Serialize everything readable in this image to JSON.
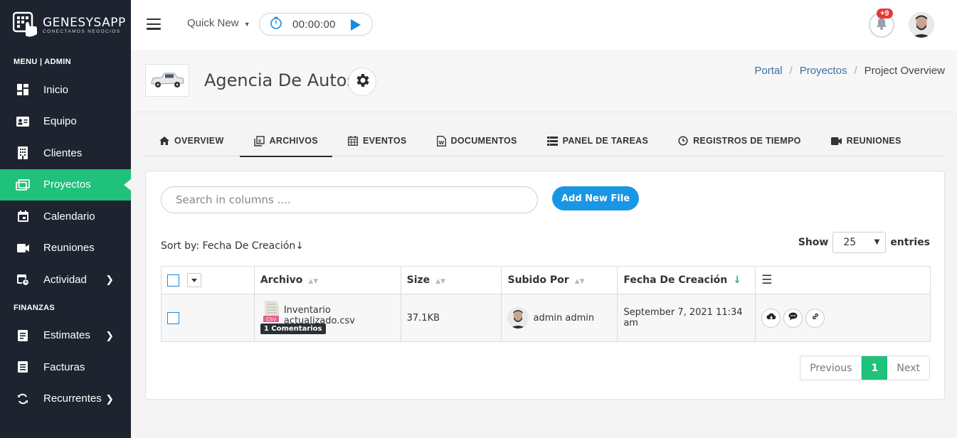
{
  "logo": {
    "title": "GENESYSAPP",
    "subtitle": "CONECTAMOS NEGOCIOS"
  },
  "sidebar": {
    "menu_section": "MENU | ADMIN",
    "menu_items": [
      {
        "label": "Inicio",
        "icon": "dashboard-icon",
        "active": false,
        "has_submenu": false
      },
      {
        "label": "Equipo",
        "icon": "id-card-icon",
        "active": false,
        "has_submenu": false
      },
      {
        "label": "Clientes",
        "icon": "building-icon",
        "active": false,
        "has_submenu": false
      },
      {
        "label": "Proyectos",
        "icon": "folders-icon",
        "active": true,
        "has_submenu": false
      },
      {
        "label": "Calendario",
        "icon": "calendar-icon",
        "active": false,
        "has_submenu": false
      },
      {
        "label": "Reuniones",
        "icon": "video-camera-icon",
        "active": false,
        "has_submenu": false
      },
      {
        "label": "Actividad",
        "icon": "calendar-clock-icon",
        "active": false,
        "has_submenu": true
      }
    ],
    "finance_section": "FINANZAS",
    "finance_items": [
      {
        "label": "Estimates",
        "icon": "document-icon",
        "has_submenu": true
      },
      {
        "label": "Facturas",
        "icon": "invoice-icon",
        "has_submenu": false
      },
      {
        "label": "Recurrentes",
        "icon": "refresh-icon",
        "has_submenu": true
      }
    ],
    "active_color": "#1fc17b"
  },
  "topbar": {
    "quick_new": "Quick New",
    "timer": "00:00:00",
    "notification_count": "+9"
  },
  "header": {
    "project_title": "Agencia De Autos",
    "breadcrumb": [
      "Portal",
      "Proyectos",
      "Project Overview"
    ]
  },
  "tabs": [
    {
      "label": "OVERVIEW",
      "icon": "home-icon",
      "active": false
    },
    {
      "label": "ARCHIVOS",
      "icon": "files-icon",
      "active": true
    },
    {
      "label": "EVENTOS",
      "icon": "calendar-icon",
      "active": false
    },
    {
      "label": "DOCUMENTOS",
      "icon": "word-document-icon",
      "active": false
    },
    {
      "label": "PANEL DE TAREAS",
      "icon": "tasks-icon",
      "active": false
    },
    {
      "label": "REGISTROS DE TIEMPO",
      "icon": "clock-icon",
      "active": false
    },
    {
      "label": "REUNIONES",
      "icon": "video-camera-icon",
      "active": false
    }
  ],
  "files": {
    "search_placeholder": "Search in columns ....",
    "add_button": "Add New File",
    "sort_by": "Sort by: Fecha De Creación↓",
    "show_label": "Show",
    "entries_value": "25",
    "entries_label": "entries",
    "columns": [
      "Archivo",
      "Size",
      "Subido Por",
      "Fecha De Creación"
    ],
    "rows": [
      {
        "file_name": "Inventario actualizado.csv",
        "file_type": "CSV",
        "comments": "1 Comentarios",
        "size": "37.1KB",
        "uploaded_by": "admin admin",
        "created": "September 7, 2021 11:34 am"
      }
    ],
    "pagination": {
      "previous": "Previous",
      "current": "1",
      "next": "Next"
    }
  }
}
